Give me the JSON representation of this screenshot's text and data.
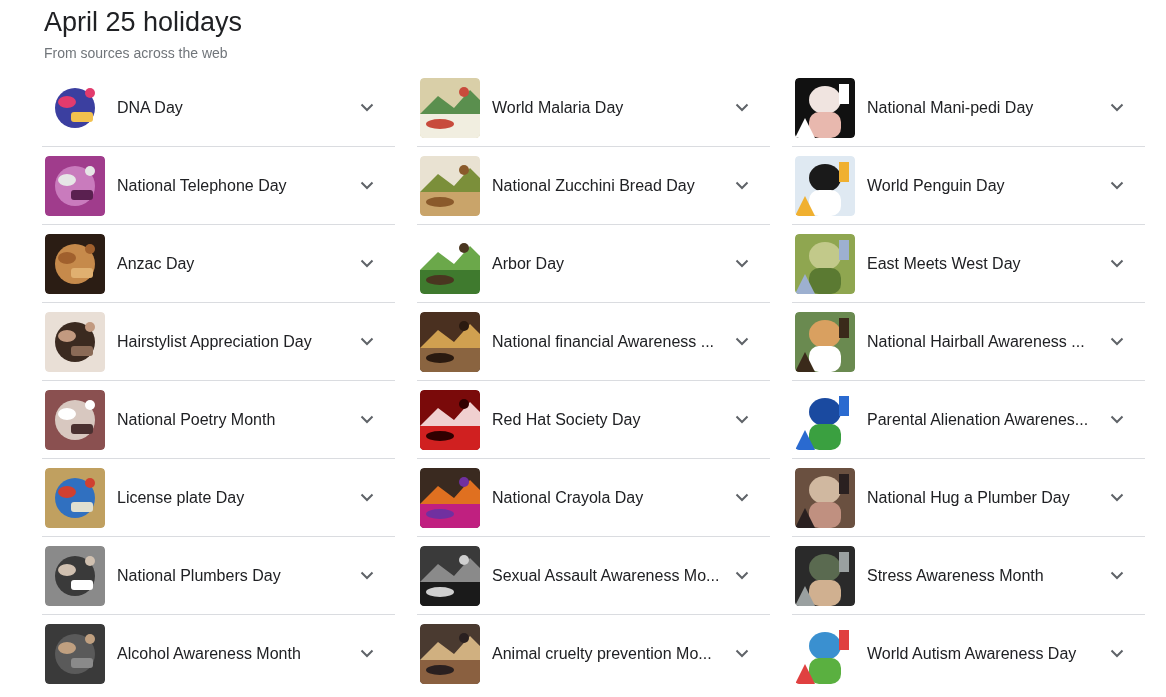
{
  "title": "April 25 holidays",
  "subtitle": "From sources across the web",
  "holidays": [
    {
      "name": "DNA Day",
      "expanded": false
    },
    {
      "name": "World Malaria Day",
      "expanded": false
    },
    {
      "name": "National Mani-pedi Day",
      "expanded": false
    },
    {
      "name": "National Telephone Day",
      "expanded": false
    },
    {
      "name": "National Zucchini Bread Day",
      "expanded": false
    },
    {
      "name": "World Penguin Day",
      "expanded": false
    },
    {
      "name": "Anzac Day",
      "expanded": false
    },
    {
      "name": "Arbor Day",
      "expanded": false
    },
    {
      "name": "East Meets West Day",
      "expanded": false
    },
    {
      "name": "Hairstylist Appreciation Day",
      "expanded": false
    },
    {
      "name": "National financial Awareness ...",
      "expanded": false
    },
    {
      "name": "National Hairball Awareness ...",
      "expanded": false
    },
    {
      "name": "National Poetry Month",
      "expanded": false
    },
    {
      "name": "Red Hat Society Day",
      "expanded": false
    },
    {
      "name": "Parental Alienation Awarenes...",
      "expanded": false
    },
    {
      "name": "License plate Day",
      "expanded": false
    },
    {
      "name": "National Crayola Day",
      "expanded": false
    },
    {
      "name": "National Hug a Plumber Day",
      "expanded": false
    },
    {
      "name": "National Plumbers Day",
      "expanded": false
    },
    {
      "name": "Sexual Assault Awareness Mo...",
      "expanded": false
    },
    {
      "name": "Stress Awareness Month",
      "expanded": false
    },
    {
      "name": "Alcohol Awareness Month",
      "expanded": false
    },
    {
      "name": "Animal cruelty prevention Mo...",
      "expanded": false
    },
    {
      "name": "World Autism Awareness Day",
      "expanded": false
    }
  ]
}
